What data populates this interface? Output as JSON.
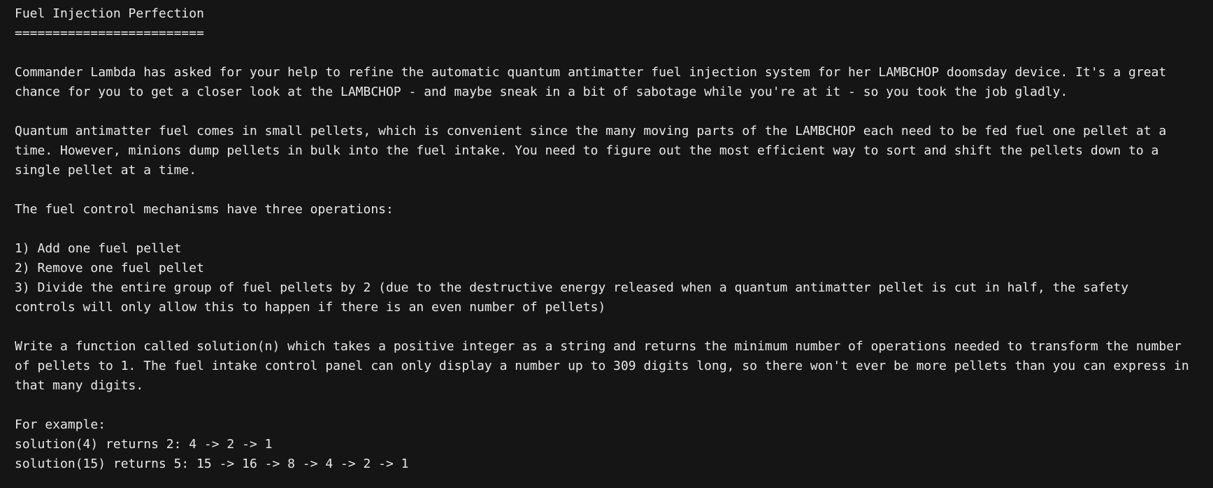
{
  "title": "Fuel Injection Perfection",
  "underline": "=========================",
  "paragraph1": {
    "line1": "Commander Lambda has asked for your help to refine the automatic quantum antimatter fuel injection system for her LAMBCHOP doomsday device. It's a great",
    "line2": "chance for you to get a closer look at the LAMBCHOP - and maybe sneak in a bit of sabotage while you're at it - so you took the job gladly."
  },
  "paragraph2": {
    "line1": "Quantum antimatter fuel comes in small pellets, which is convenient since the many moving parts of the LAMBCHOP each need to be fed fuel one pellet at a",
    "line2": "time. However, minions dump pellets in bulk into the fuel intake. You need to figure out the most efficient way to sort and shift the pellets down to a",
    "line3": "single pellet at a time."
  },
  "operations_intro": "The fuel control mechanisms have three operations:",
  "operations": {
    "op1": "1) Add one fuel pellet",
    "op2": "2) Remove one fuel pellet",
    "op3_line1": "3) Divide the entire group of fuel pellets by 2 (due to the destructive energy released when a quantum antimatter pellet is cut in half, the safety",
    "op3_line2": "controls will only allow this to happen if there is an even number of pellets)"
  },
  "paragraph3": {
    "line1": "Write a function called solution(n) which takes a positive integer as a string and returns the minimum number of operations needed to transform the number",
    "line2": "of pellets to 1. The fuel intake control panel can only display a number up to 309 digits long, so there won't ever be more pellets than you can express in",
    "line3": "that many digits."
  },
  "examples": {
    "heading": "For example:",
    "ex1": "solution(4) returns 2: 4 -> 2 -> 1",
    "ex2": "solution(15) returns 5: 15 -> 16 -> 8 -> 4 -> 2 -> 1"
  }
}
